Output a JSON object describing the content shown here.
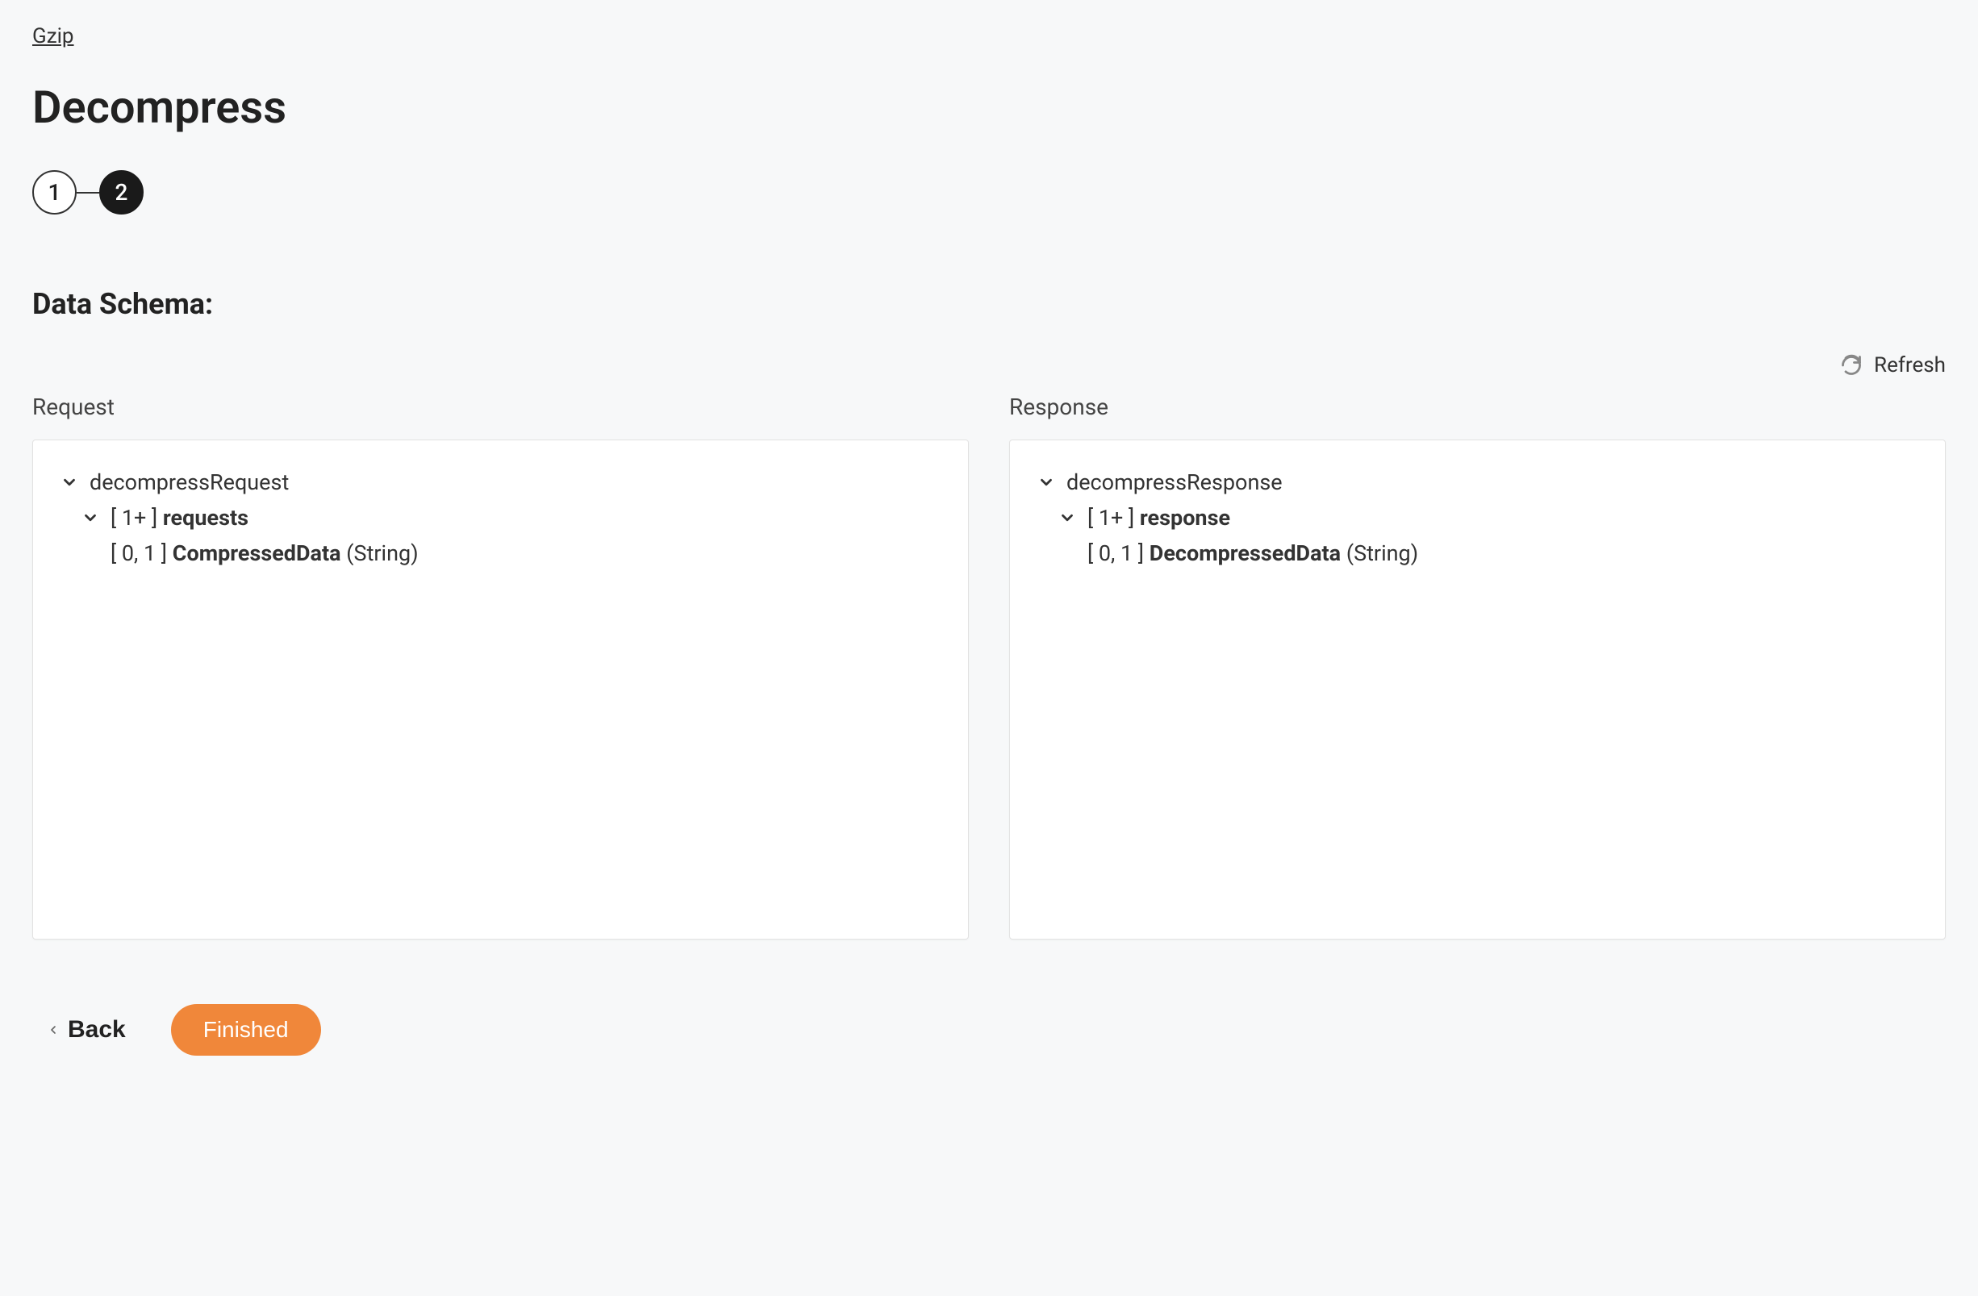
{
  "breadcrumb": {
    "label": "Gzip"
  },
  "page": {
    "title": "Decompress"
  },
  "stepper": {
    "steps": [
      {
        "label": "1",
        "active": false
      },
      {
        "label": "2",
        "active": true
      }
    ]
  },
  "section": {
    "title": "Data Schema:"
  },
  "refresh": {
    "label": "Refresh"
  },
  "request": {
    "heading": "Request",
    "root": "decompressRequest",
    "array_label": "[ 1+ ]",
    "array_name": "requests",
    "leaf_card": "[ 0, 1 ]",
    "leaf_name": "CompressedData",
    "leaf_type": "(String)"
  },
  "response": {
    "heading": "Response",
    "root": "decompressResponse",
    "array_label": "[ 1+ ]",
    "array_name": "response",
    "leaf_card": "[ 0, 1 ]",
    "leaf_name": "DecompressedData",
    "leaf_type": "(String)"
  },
  "footer": {
    "back_label": "Back",
    "finished_label": "Finished"
  }
}
